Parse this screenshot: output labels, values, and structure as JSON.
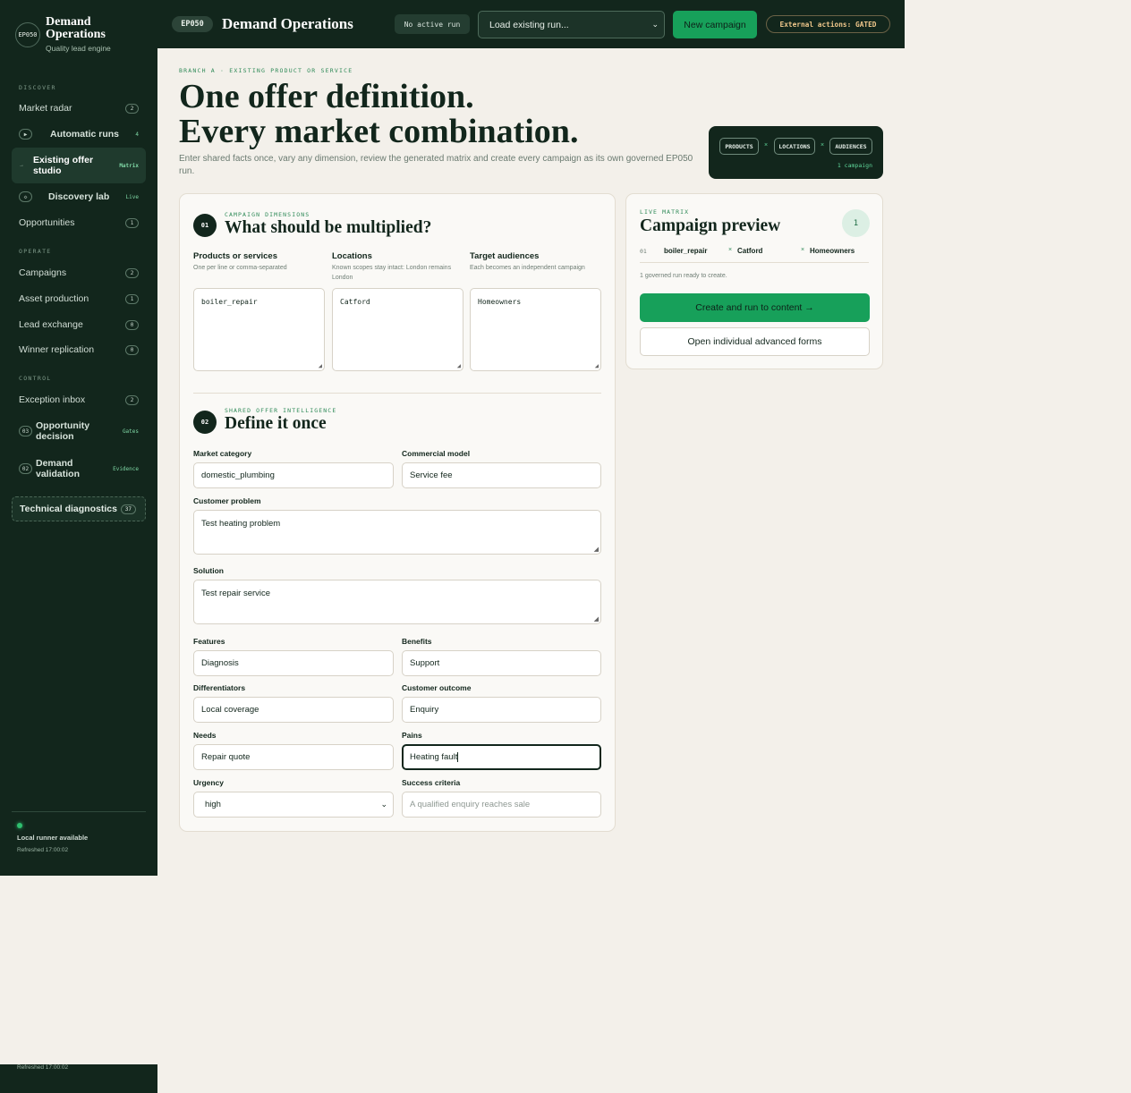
{
  "brand": {
    "badge": "EP050",
    "title_line1": "Demand",
    "title_line2": "Operations",
    "subtitle": "Quality lead engine"
  },
  "sidebar": {
    "sections": {
      "discover": "DISCOVER",
      "operate": "OPERATE",
      "control": "CONTROL"
    },
    "items": [
      {
        "label": "Market radar",
        "count": "2"
      },
      {
        "label": "Automatic runs",
        "count": "4",
        "icon": "▶"
      },
      {
        "label": "Existing offer studio",
        "tag": "Matrix"
      },
      {
        "label": "Discovery lab",
        "tag": "Live",
        "icon": "◇"
      },
      {
        "label": "Opportunities",
        "count": "1"
      },
      {
        "label": "Campaigns",
        "count": "2"
      },
      {
        "label": "Asset production",
        "count": "1"
      },
      {
        "label": "Lead exchange",
        "count": "0"
      },
      {
        "label": "Winner replication",
        "count": "0"
      },
      {
        "label": "Exception inbox",
        "count": "2"
      },
      {
        "label": "Opportunity decision",
        "tag": "Gates",
        "icon": "03"
      },
      {
        "label": "Demand validation",
        "tag": "Evidence",
        "icon": "02"
      }
    ],
    "diagnostics": {
      "label": "Technical diagnostics",
      "count": "37"
    },
    "footer": {
      "runner": "Local runner available",
      "refreshed": "Refreshed 17:00:02"
    },
    "bottom_refreshed": "Refreshed 17:00:02"
  },
  "topbar": {
    "run_pill": "EP050",
    "title": "Demand Operations",
    "no_run": "No active run",
    "load_select": "Load existing run...",
    "new_campaign": "New campaign",
    "gated": "External actions: GATED"
  },
  "hero": {
    "eyebrow": "BRANCH A · EXISTING PRODUCT OR SERVICE",
    "title_line1": "One offer definition.",
    "title_line2": "Every market combination.",
    "subtitle": "Enter shared facts once, vary any dimension, review the generated matrix and create every campaign as its own governed EP050 run.",
    "dims": {
      "products": "PRODUCTS",
      "locations": "LOCATIONS",
      "audiences": "AUDIENCES",
      "times": "×",
      "count": "1 campaign"
    }
  },
  "step1": {
    "number": "01",
    "eyebrow": "CAMPAIGN DIMENSIONS",
    "title": "What should be multiplied?",
    "columns": [
      {
        "head": "Products or services",
        "help": "One per line or comma-separated",
        "value": "boiler_repair"
      },
      {
        "head": "Locations",
        "help": "Known scopes stay intact: London remains London",
        "value": "Catford"
      },
      {
        "head": "Target audiences",
        "help": "Each becomes an independent campaign",
        "value": "Homeowners"
      }
    ]
  },
  "step2": {
    "number": "02",
    "eyebrow": "SHARED OFFER INTELLIGENCE",
    "title": "Define it once",
    "fields": {
      "market_category": {
        "label": "Market category",
        "value": "domestic_plumbing"
      },
      "commercial_model": {
        "label": "Commercial model",
        "value": "Service fee"
      },
      "customer_problem": {
        "label": "Customer problem",
        "value": "Test heating problem"
      },
      "solution": {
        "label": "Solution",
        "value": "Test repair service"
      },
      "features": {
        "label": "Features",
        "value": "Diagnosis"
      },
      "benefits": {
        "label": "Benefits",
        "value": "Support"
      },
      "differentiators": {
        "label": "Differentiators",
        "value": "Local coverage"
      },
      "customer_outcome": {
        "label": "Customer outcome",
        "value": "Enquiry"
      },
      "needs": {
        "label": "Needs",
        "value": "Repair quote"
      },
      "pains": {
        "label": "Pains",
        "value": "Heating fault"
      },
      "urgency": {
        "label": "Urgency",
        "value": "high"
      },
      "success_criteria": {
        "label": "Success criteria",
        "placeholder": "A qualified enquiry reaches sale"
      }
    }
  },
  "preview": {
    "eyebrow": "LIVE MATRIX",
    "title": "Campaign preview",
    "count": "1",
    "row": {
      "index": "01",
      "product": "boiler_repair",
      "location": "Catford",
      "audience": "Homeowners",
      "times": "×"
    },
    "ready": "1 governed run ready to create.",
    "primary": "Create and run to content →",
    "secondary": "Open individual advanced forms"
  }
}
